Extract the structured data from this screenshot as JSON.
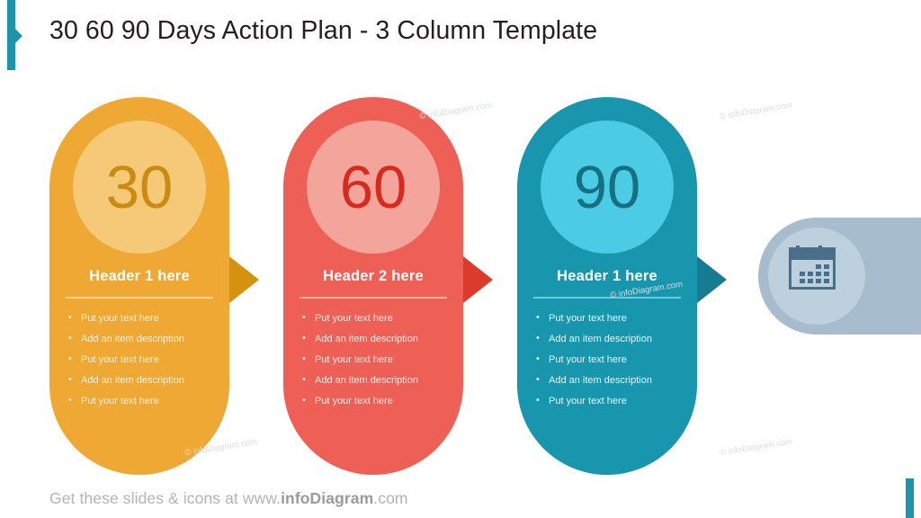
{
  "slide": {
    "title": "30 60 90 Days Action Plan - 3 Column Template",
    "footer_prefix": "Get these slides & icons at www.",
    "footer_brand": "infoDiagram",
    "footer_suffix": ".com",
    "watermark": "© infoDiagram.com",
    "accent_color": "#1e94ac"
  },
  "columns": [
    {
      "number": "30",
      "header": "Header 1 here",
      "color": "#efa833",
      "circle_color": "#f6c978",
      "number_color": "#cb8b12",
      "arrow_color": "#d4920f",
      "bullets": [
        "Put your text here",
        "Add an item description",
        "Put your text here",
        "Add an item description",
        "Put your text here"
      ]
    },
    {
      "number": "60",
      "header": "Header 2 here",
      "color": "#ee6055",
      "circle_color": "#f3a59c",
      "number_color": "#d8291c",
      "arrow_color": "#dc3b2b",
      "bullets": [
        "Put your text here",
        "Add an item description",
        "Put your text here",
        "Add an item description",
        "Put your text here"
      ]
    },
    {
      "number": "90",
      "header": "Header 1 here",
      "color": "#1796ae",
      "circle_color": "#4ccbe4",
      "number_color": "#15707f",
      "arrow_color": "#177c91",
      "bullets": [
        "Put your text here",
        "Add an item description",
        "Put your text here",
        "Add an item description",
        "Put your text here"
      ]
    }
  ],
  "icon_panel": {
    "icon": "calendar-icon",
    "panel_color": "#a7bccd",
    "disc_color": "#bcd0dd",
    "icon_color": "#4a6f8a"
  }
}
